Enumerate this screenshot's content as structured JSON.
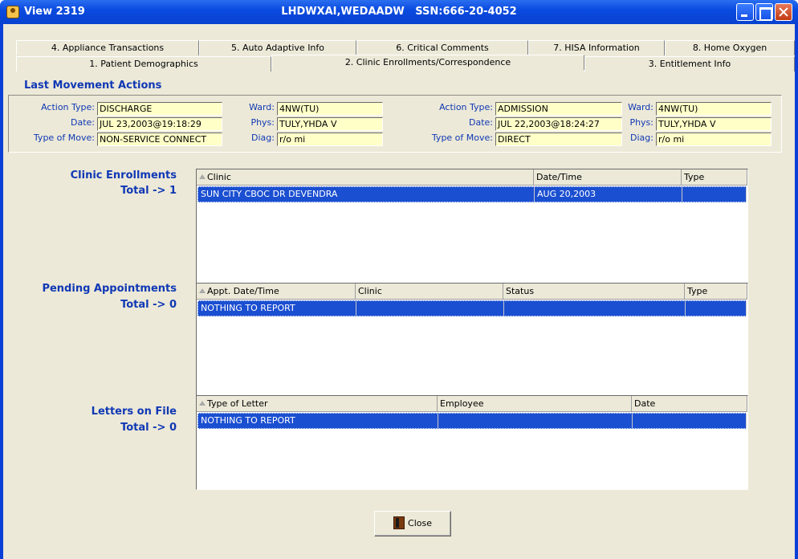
{
  "window": {
    "title": "View 2319",
    "patient": "LHDWXAI,WEDAADW",
    "ssn_label": "SSN:",
    "ssn": "666-20-4052"
  },
  "tabs_row1": [
    "4. Appliance Transactions",
    "5. Auto Adaptive Info",
    "6. Critical Comments",
    "7. HISA Information",
    "8. Home Oxygen"
  ],
  "tabs_row2": [
    "1. Patient Demographics",
    "2. Clinic Enrollments/Correspondence",
    "3. Entitlement Info"
  ],
  "last_movement": {
    "title": "Last Movement Actions",
    "labels": {
      "action_type": "Action Type:",
      "date": "Date:",
      "type_of_move": "Type of Move:",
      "ward": "Ward:",
      "phys": "Phys:",
      "diag": "Diag:"
    },
    "discharge": {
      "action_type": "DISCHARGE",
      "date": "JUL 23,2003@19:18:29",
      "type_of_move": "NON-SERVICE CONNECT",
      "ward": "4NW(TU)",
      "phys": "TULY,YHDA V",
      "diag": "r/o mi"
    },
    "admission": {
      "action_type": "ADMISSION",
      "date": "JUL 22,2003@18:24:27",
      "type_of_move": "DIRECT",
      "ward": "4NW(TU)",
      "phys": "TULY,YHDA V",
      "diag": "r/o mi"
    }
  },
  "clinic_enrollments": {
    "title": "Clinic Enrollments",
    "total": "Total -> 1",
    "columns": [
      "Clinic",
      "Date/Time",
      "Type"
    ],
    "rows": [
      [
        "SUN CITY CBOC DR DEVENDRA",
        "AUG 20,2003",
        ""
      ]
    ]
  },
  "pending_appointments": {
    "title": "Pending Appointments",
    "total": "Total -> 0",
    "columns": [
      "Appt. Date/Time",
      "Clinic",
      "Status",
      "Type"
    ],
    "rows": [
      [
        "NOTHING TO REPORT",
        "",
        "",
        ""
      ]
    ]
  },
  "letters_on_file": {
    "title": "Letters on File",
    "total": "Total -> 0",
    "columns": [
      "Type of Letter",
      "Employee",
      "Date"
    ],
    "rows": [
      [
        "NOTHING TO REPORT",
        "",
        ""
      ]
    ]
  },
  "close_button": "Close",
  "colors": {
    "titlebar": "#0a4be0",
    "label_blue": "#1038b5",
    "selection": "#1b4fd1",
    "field_bg": "#ffffc8"
  }
}
